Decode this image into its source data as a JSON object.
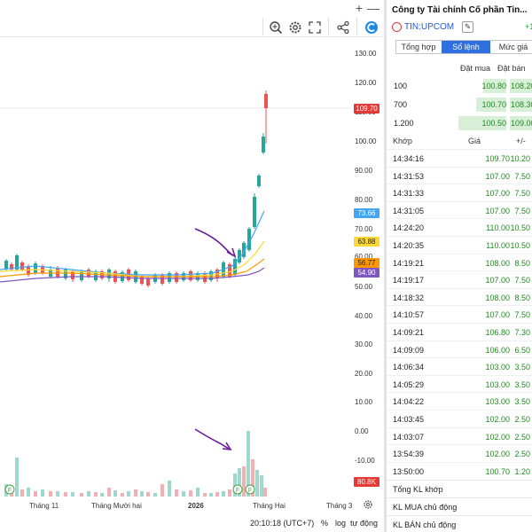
{
  "toolbar": {
    "icons": [
      "plus-icon",
      "minimize-icon",
      "zoom-search-icon",
      "settings-icon",
      "fullscreen-icon",
      "share-icon",
      "logo-icon"
    ]
  },
  "chart": {
    "price_ticks": [
      "130.00",
      "120.00",
      "110.00",
      "100.00",
      "90.00",
      "80.00",
      "70.00",
      "60.00",
      "50.00",
      "40.00",
      "30.00",
      "20.00",
      "10.00",
      "0.00",
      "-10.00"
    ],
    "badges": [
      {
        "label": "109.70",
        "bg": "#e53935",
        "fg": "#ffffff"
      },
      {
        "label": "73.66",
        "bg": "#42a5f5",
        "fg": "#ffffff"
      },
      {
        "label": "63.88",
        "bg": "#fdd835",
        "fg": "#222222"
      },
      {
        "label": "56.77",
        "bg": "#ff9800",
        "fg": "#222222"
      },
      {
        "label": "54.90",
        "bg": "#7e57c2",
        "fg": "#ffffff"
      },
      {
        "label": "80.8K",
        "bg": "#e53935",
        "fg": "#ffffff"
      }
    ],
    "time_ticks": [
      {
        "label": "Tháng 11",
        "bold": false
      },
      {
        "label": "Tháng Mười hai",
        "bold": false
      },
      {
        "label": "2026",
        "bold": true
      },
      {
        "label": "Tháng Hai",
        "bold": false
      },
      {
        "label": "Tháng 3",
        "bold": false
      }
    ],
    "event_marker": "F",
    "colors": {
      "up": "#26a69a",
      "down": "#ef5350",
      "ma_blue": "#42a5f5",
      "ma_yellow": "#fdd835",
      "ma_orange": "#ff9800",
      "ma_purple": "#7e57c2",
      "arrow": "#6a1b9a"
    }
  },
  "bottom_bar": {
    "clock": "20:10:18 (UTC+7)",
    "percent": "%",
    "log": "log",
    "auto": "tự động"
  },
  "panel": {
    "company": "Công ty Tài chính Cổ phần Tin...",
    "ticker": "TIN:UPCOM",
    "change": "+1",
    "tabs": [
      "Tổng hợp",
      "Sổ lệnh",
      "Mức giá"
    ],
    "active_tab": 1,
    "orderbook": {
      "bid_header": "Đặt mua",
      "ask_header": "Đặt bán",
      "rows": [
        {
          "vol": "100",
          "bid": "100.80",
          "ask": "108.20"
        },
        {
          "vol": "700",
          "bid": "100.70",
          "ask": "108.30"
        },
        {
          "vol": "1.200",
          "bid": "100.50",
          "ask": "109.00"
        }
      ]
    },
    "trades": {
      "headers": [
        "Khớp",
        "Giá",
        "+/-"
      ],
      "rows": [
        {
          "time": "14:34:16",
          "price": "109.70",
          "chg": "10.20"
        },
        {
          "time": "14:31:53",
          "price": "107.00",
          "chg": "7.50"
        },
        {
          "time": "14:31:33",
          "price": "107.00",
          "chg": "7.50"
        },
        {
          "time": "14:31:05",
          "price": "107.00",
          "chg": "7.50"
        },
        {
          "time": "14:24:20",
          "price": "110.00",
          "chg": "10.50"
        },
        {
          "time": "14:20:35",
          "price": "110.00",
          "chg": "10.50"
        },
        {
          "time": "14:19:21",
          "price": "108.00",
          "chg": "8.50"
        },
        {
          "time": "14:19:17",
          "price": "107.00",
          "chg": "7.50"
        },
        {
          "time": "14:18:32",
          "price": "108.00",
          "chg": "8.50"
        },
        {
          "time": "14:10:57",
          "price": "107.00",
          "chg": "7.50"
        },
        {
          "time": "14:09:21",
          "price": "106.80",
          "chg": "7.30"
        },
        {
          "time": "14:09:09",
          "price": "106.00",
          "chg": "6.50"
        },
        {
          "time": "14:06:34",
          "price": "103.00",
          "chg": "3.50"
        },
        {
          "time": "14:05:29",
          "price": "103.00",
          "chg": "3.50"
        },
        {
          "time": "14:04:22",
          "price": "103.00",
          "chg": "3.50"
        },
        {
          "time": "14:03:45",
          "price": "102.00",
          "chg": "2.50"
        },
        {
          "time": "14:03:07",
          "price": "102.00",
          "chg": "2.50"
        },
        {
          "time": "13:54:39",
          "price": "102.00",
          "chg": "2.50"
        },
        {
          "time": "13:50:00",
          "price": "100.70",
          "chg": "1.20"
        }
      ]
    },
    "summary": [
      "Tổng KL khớp",
      "KL MUA chủ động",
      "KL BÁN chủ động"
    ]
  }
}
